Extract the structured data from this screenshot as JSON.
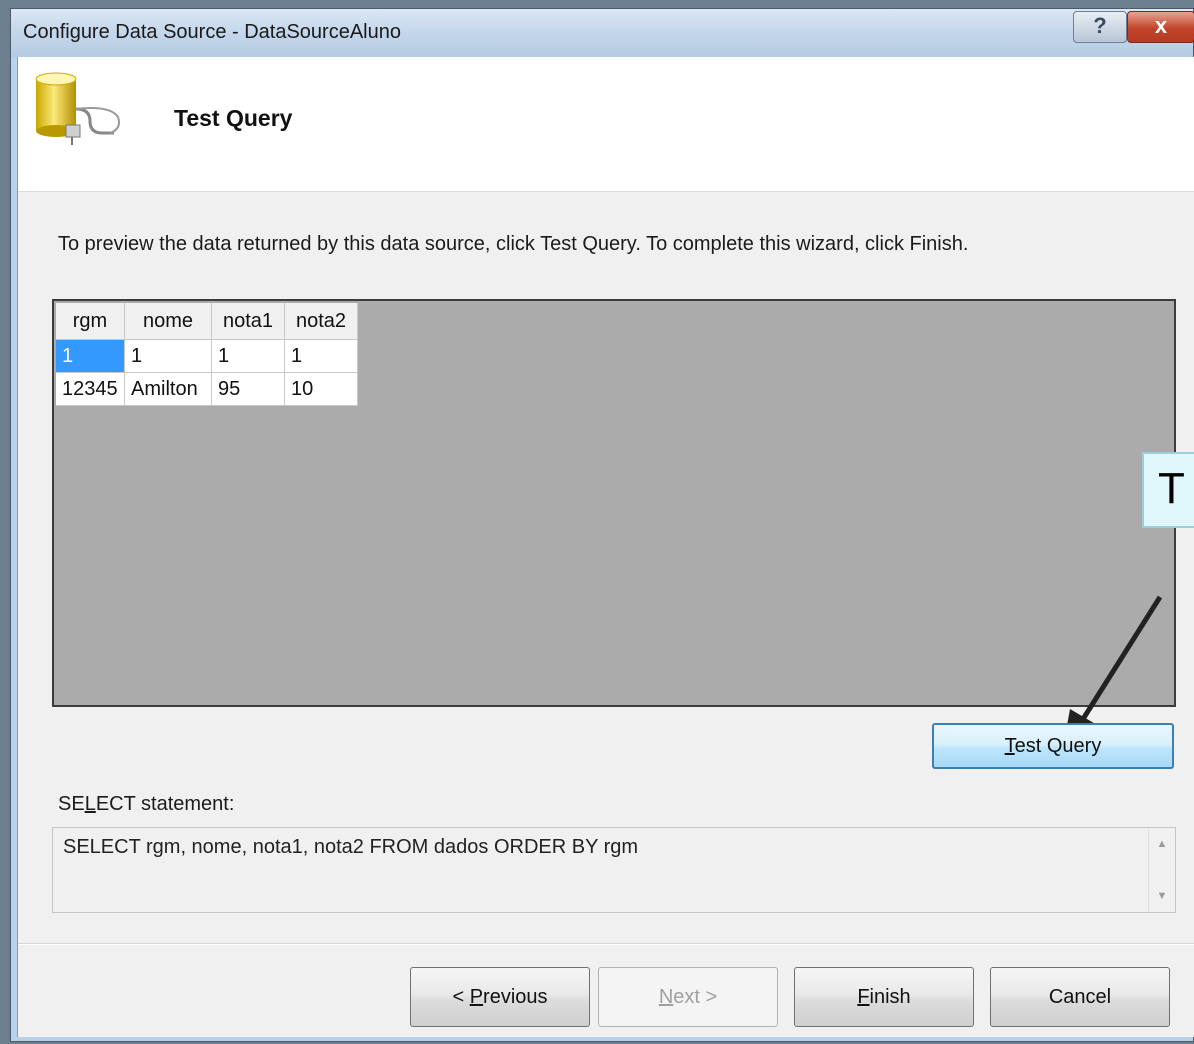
{
  "window": {
    "title": "Configure Data Source - DataSourceAluno",
    "help_label": "?",
    "close_label": "x"
  },
  "wizard": {
    "heading": "Test Query",
    "icon": "database-plug-icon",
    "instructions": "To preview the data returned by this data source, click Test Query. To complete this wizard, click Finish."
  },
  "results": {
    "columns": [
      "rgm",
      "nome",
      "nota1",
      "nota2"
    ],
    "rows": [
      [
        "1",
        "1",
        "1",
        "1"
      ],
      [
        "12345",
        "Amilton",
        "95",
        "10"
      ]
    ]
  },
  "callout": {
    "text": "T"
  },
  "test_query_button": {
    "mnemonic": "T",
    "rest": "est Query"
  },
  "select": {
    "label_pre": "SE",
    "label_mnemonic": "L",
    "label_post": "ECT statement:",
    "statement": "SELECT rgm, nome, nota1, nota2 FROM dados ORDER BY rgm"
  },
  "buttons": {
    "previous": {
      "pre": "< ",
      "mnemonic": "P",
      "rest": "revious"
    },
    "next": {
      "mnemonic": "N",
      "rest": "ext >"
    },
    "finish": {
      "mnemonic": "F",
      "rest": "inish"
    },
    "cancel": {
      "label": "Cancel"
    }
  },
  "colors": {
    "selection": "#3399ff",
    "grid_background": "#ababab",
    "close_button": "#c1442b"
  }
}
